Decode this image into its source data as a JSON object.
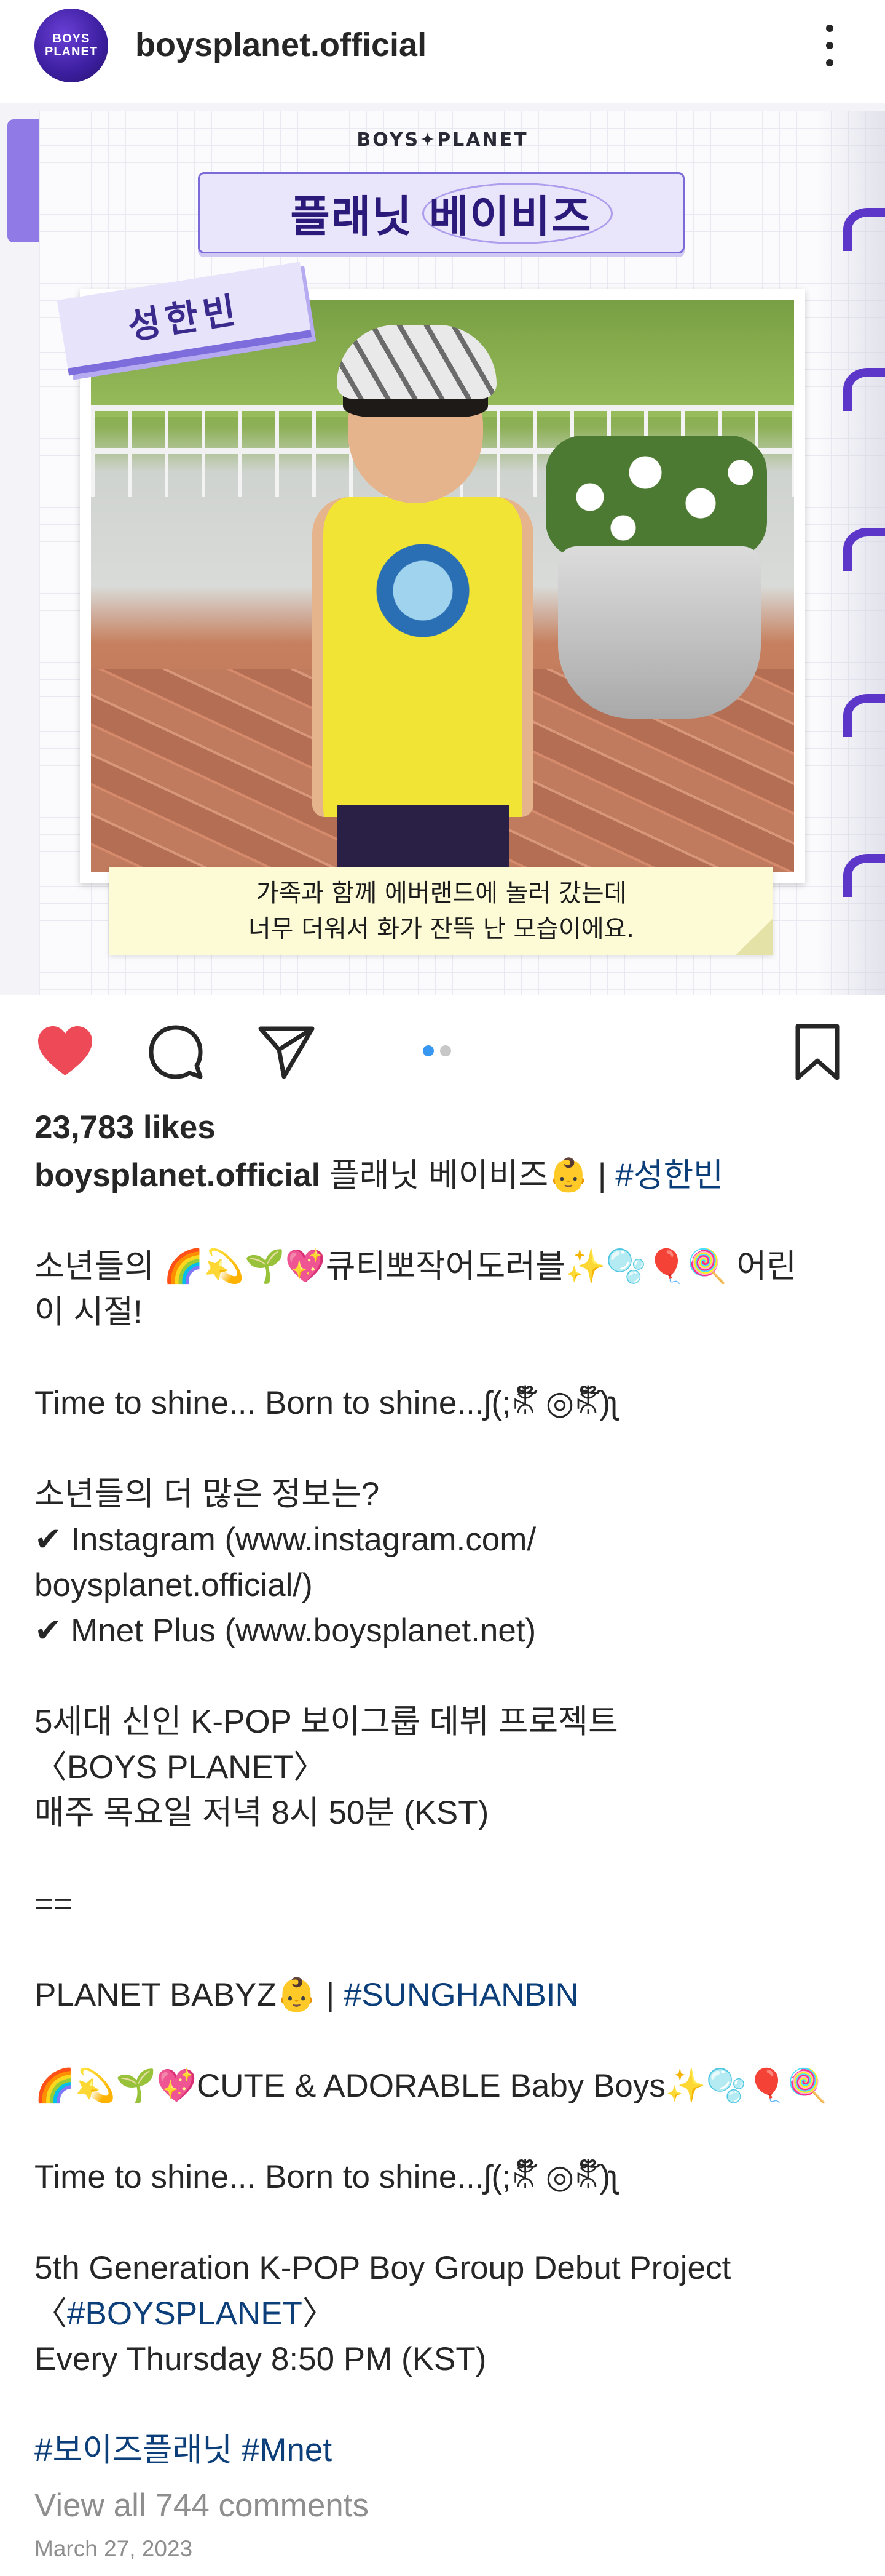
{
  "account": {
    "username": "boysplanet.official",
    "avatar_line1": "BOYS",
    "avatar_line2": "PLANET"
  },
  "post_image": {
    "brand": "BOYS✦PLANET",
    "title": "플래닛 베이비즈",
    "name_tag": "성한빈",
    "caption_line1": "가족과 함께 에버랜드에 놀러 갔는데",
    "caption_line2": "너무 더워서 화가 잔뜩 난 모습이에요."
  },
  "carousel": {
    "count": 2,
    "active_index": 0
  },
  "actions": {
    "like_icon": "heart-filled-icon",
    "comment_icon": "comment-icon",
    "share_icon": "send-icon",
    "save_icon": "bookmark-icon",
    "like_color": "#ed4956"
  },
  "likes_text": "23,783 likes",
  "caption": {
    "author": "boysplanet.official",
    "headline": " 플래닛 베이비즈👶 | ",
    "headline_tag": "#성한빈",
    "kr_line1": "소년들의 🌈💫🌱💖큐티뽀작어도러블✨🫧🎈🍭 어린",
    "kr_line2": "이 시절!",
    "shine": "Time to shine... Born to shine...ʃ(;ꌿ໊ ◎ꌿ໊)ʅ",
    "more_info": "소년들의 더 많은 정보는?",
    "insta_line1": "✔ Instagram (www.instagram.com/",
    "insta_line2": "boysplanet.official/)",
    "mnet_line": "✔ Mnet Plus (www.boysplanet.net)",
    "project_kr": "5세대 신인 K-POP 보이그룹 데뷔 프로젝트",
    "project_kr_name": "〈BOYS PLANET〉",
    "schedule_kr": "매주 목요일 저녁 8시 50분 (KST)",
    "divider": "==",
    "en_head": "PLANET BABYZ👶 | ",
    "en_head_tag": "#SUNGHANBIN",
    "en_line": "🌈💫🌱💖CUTE & ADORABLE Baby Boys✨🫧🎈🍭",
    "shine_en": "Time to shine... Born to shine...ʃ(;ꌿ໊ ◎ꌿ໊)ʅ",
    "project_en": "5th Generation K-POP Boy Group Debut Project",
    "project_en_open": "〈",
    "project_en_tag": "#BOYSPLANET",
    "project_en_close": "〉",
    "schedule_en": "Every Thursday 8:50 PM (KST)",
    "tag1": "#보이즈플래닛",
    "tag2": "#Mnet"
  },
  "comments_link": "View all 744 comments",
  "date": "March 27, 2023"
}
